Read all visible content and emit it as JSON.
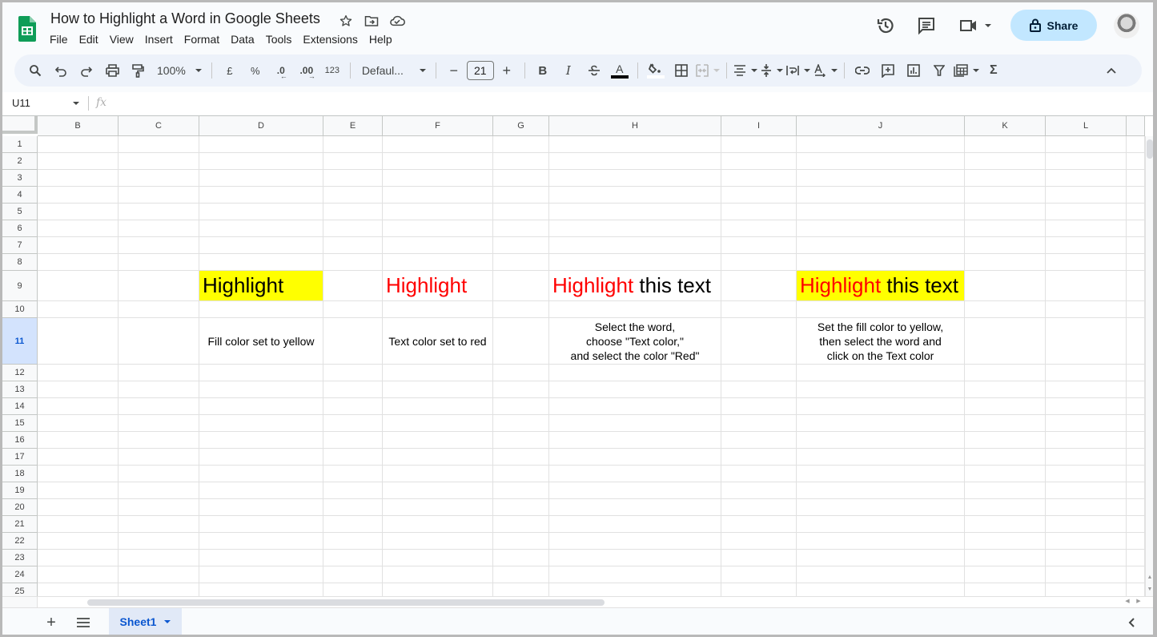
{
  "app": {
    "title": "How to Highlight a Word in Google Sheets",
    "brand_color": "#0f9d58",
    "menu": [
      "File",
      "Edit",
      "View",
      "Insert",
      "Format",
      "Data",
      "Tools",
      "Extensions",
      "Help"
    ],
    "title_icons": [
      "star-icon",
      "move-to-folder-icon",
      "cloud-saved-icon"
    ],
    "share_label": "Share",
    "top_right_icons": [
      "version-history-icon",
      "comments-icon",
      "meet-video-icon"
    ]
  },
  "toolbar": {
    "zoom": "100%",
    "currency": "£",
    "percent": "%",
    "decrease_decimal": ".0",
    "increase_decimal": ".00",
    "more_formats": "123",
    "font": "Defaul...",
    "font_size": "21",
    "minus": "−",
    "plus": "+",
    "bold": "B",
    "italic": "I",
    "text_color_bar": "#000000",
    "fill_color_bar": "#ffffff",
    "sum": "Σ"
  },
  "formula_bar": {
    "name_box": "U11",
    "fx": "fx",
    "value": ""
  },
  "grid": {
    "columns": [
      "B",
      "C",
      "D",
      "E",
      "F",
      "G",
      "H",
      "I",
      "J",
      "K",
      "L"
    ],
    "rows": [
      "1",
      "2",
      "3",
      "4",
      "5",
      "6",
      "7",
      "8",
      "9",
      "10",
      "11",
      "12",
      "13",
      "14",
      "15",
      "16",
      "17",
      "18",
      "19",
      "20",
      "21",
      "22",
      "23",
      "24",
      "25"
    ],
    "selected_row": "11",
    "cells": {
      "D9": {
        "text": "Highlight",
        "fill": "#ffff00",
        "color": "#000000"
      },
      "F9": {
        "text": "Highlight",
        "color": "#ff0000"
      },
      "H9": {
        "part1": "Highlight",
        "part1_color": "#ff0000",
        "part2": " this text",
        "part2_color": "#000000"
      },
      "J9": {
        "part1": "Highlight",
        "part1_color": "#ff0000",
        "part2": " this text",
        "part2_color": "#000000",
        "fill": "#ffff00"
      },
      "D11": {
        "text": "Fill color set to yellow"
      },
      "F11": {
        "text": "Text color set to red"
      },
      "H11": {
        "lines": [
          "Select the word,",
          "choose \"Text color,\"",
          "and select the color \"Red\""
        ]
      },
      "J11": {
        "lines": [
          "Set the fill color to yellow,",
          "then select the word and",
          "click on the Text color"
        ]
      }
    }
  },
  "sheets": {
    "add": "+",
    "tabs": [
      {
        "label": "Sheet1",
        "active": true
      }
    ]
  }
}
